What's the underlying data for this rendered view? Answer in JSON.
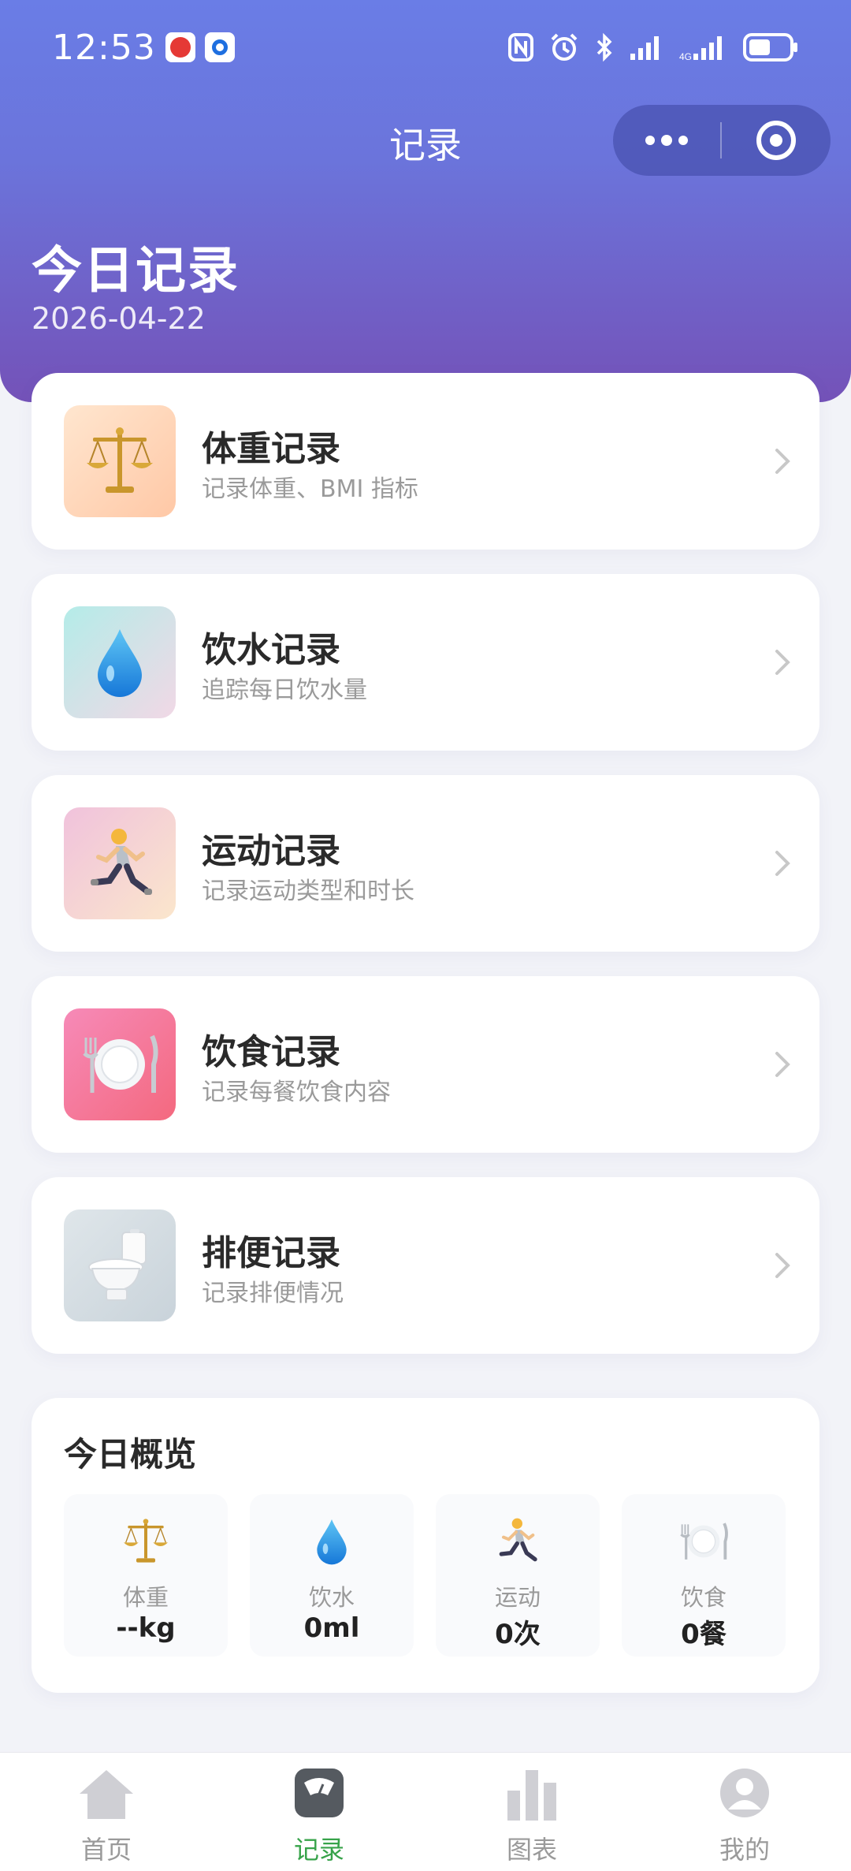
{
  "status_bar": {
    "time": "12:53"
  },
  "nav": {
    "title": "记录"
  },
  "header": {
    "title": "今日记录",
    "date": "2026-04-22"
  },
  "records": [
    {
      "title": "体重记录",
      "subtitle": "记录体重、BMI 指标",
      "icon": "scale-icon"
    },
    {
      "title": "饮水记录",
      "subtitle": "追踪每日饮水量",
      "icon": "water-drop-icon"
    },
    {
      "title": "运动记录",
      "subtitle": "记录运动类型和时长",
      "icon": "runner-icon"
    },
    {
      "title": "饮食记录",
      "subtitle": "记录每餐饮食内容",
      "icon": "plate-icon"
    },
    {
      "title": "排便记录",
      "subtitle": "记录排便情况",
      "icon": "toilet-icon"
    }
  ],
  "overview": {
    "title": "今日概览",
    "items": [
      {
        "label": "体重",
        "value": "--kg",
        "icon": "scale-icon"
      },
      {
        "label": "饮水",
        "value": "0ml",
        "icon": "water-drop-icon"
      },
      {
        "label": "运动",
        "value": "0次",
        "icon": "runner-icon"
      },
      {
        "label": "饮食",
        "value": "0餐",
        "icon": "plate-icon"
      }
    ]
  },
  "tabbar": {
    "tabs": [
      {
        "label": "首页",
        "icon": "home-icon",
        "active": false
      },
      {
        "label": "记录",
        "icon": "record-icon",
        "active": true
      },
      {
        "label": "图表",
        "icon": "chart-icon",
        "active": false
      },
      {
        "label": "我的",
        "icon": "profile-icon",
        "active": false
      }
    ]
  },
  "colors": {
    "header_gradient_top": "#6a7de6",
    "header_gradient_bottom": "#7452b8",
    "active_tab": "#37a34a",
    "background": "#f2f3f8"
  }
}
